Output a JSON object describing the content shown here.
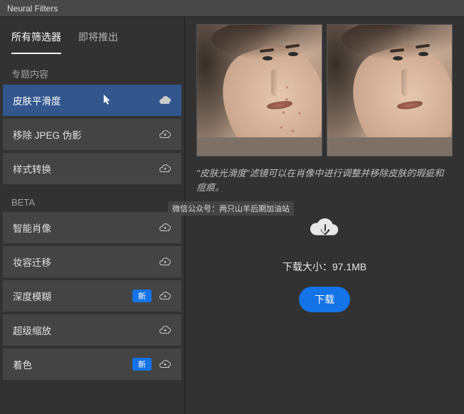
{
  "app": {
    "title": "Neural Filters"
  },
  "tabs": {
    "all": "所有筛选器",
    "coming": "即将推出"
  },
  "sections": {
    "featured": "专题内容",
    "beta": "BETA"
  },
  "filters": {
    "featured": [
      {
        "label": "皮肤平滑度",
        "new": false,
        "selected": true
      },
      {
        "label": "移除 JPEG 伪影",
        "new": false,
        "selected": false
      },
      {
        "label": "样式转换",
        "new": false,
        "selected": false
      }
    ],
    "beta": [
      {
        "label": "智能肖像",
        "new": false
      },
      {
        "label": "妆容迁移",
        "new": false
      },
      {
        "label": "深度模糊",
        "new": true
      },
      {
        "label": "超级缩放",
        "new": false
      },
      {
        "label": "着色",
        "new": true
      }
    ]
  },
  "badge": {
    "new_label": "新"
  },
  "detail": {
    "description": "\"皮肤光滑度\"滤镜可以在肖像中进行调整并移除皮肤的瑕疵和痘痕。",
    "download_size_label": "下载大小：97.1MB",
    "download_button": "下载"
  },
  "watermark": "微信公众号：两只山羊后期加油站"
}
